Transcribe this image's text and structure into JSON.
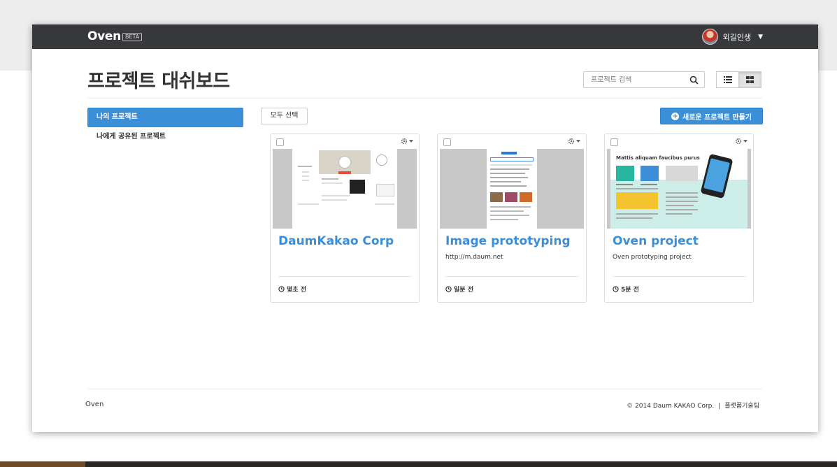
{
  "navbar": {
    "brand": "Oven",
    "beta": "BETA",
    "username": "외길인생"
  },
  "page": {
    "title": "프로젝트 대쉬보드"
  },
  "search": {
    "placeholder": "프로젝트 검색"
  },
  "sidebar": {
    "items": [
      {
        "label": "나의 프로젝트",
        "active": true
      },
      {
        "label": "나에게 공유된 프로젝트",
        "active": false
      }
    ]
  },
  "toolbar": {
    "select_all": "모두 선택",
    "new_project": "새로운 프로젝트 만들기"
  },
  "projects": [
    {
      "title": "DaumKakao Corp",
      "subtitle": "",
      "time": "몇초 전"
    },
    {
      "title": "Image prototyping",
      "subtitle": "http://m.daum.net",
      "time": "일분 전"
    },
    {
      "title": "Oven project",
      "subtitle": "Oven prototyping project",
      "time": "5분 전",
      "thumb_heading": "Mattis aliquam faucibus purus"
    }
  ],
  "footer": {
    "left": "Oven",
    "copyright": "© 2014 Daum KAKAO Corp.",
    "separator": "|",
    "link": "플랫폼기술팀"
  },
  "colors": {
    "navbar": "#37393c",
    "accent": "#3a8fd8"
  }
}
